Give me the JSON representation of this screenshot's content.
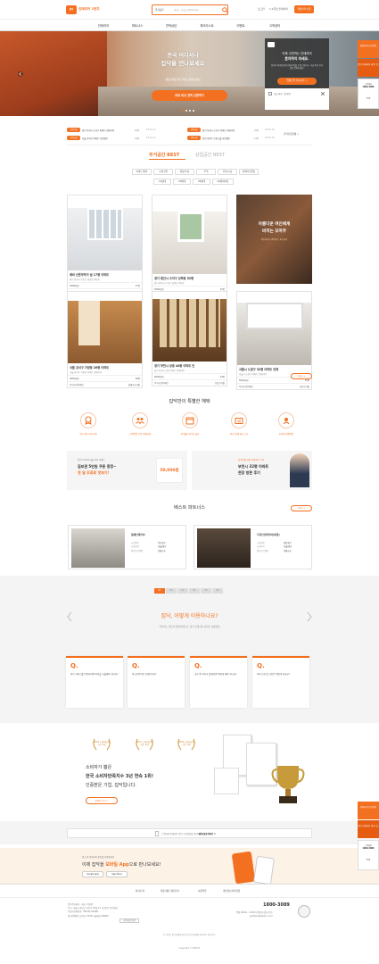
{
  "header": {
    "logo_text": "인테리어 1번지",
    "logo_badge": "집닥",
    "search_select": "주거공간",
    "search_placeholder": "원하는 공간을 검색해주세요",
    "login": "로그인",
    "phone": "1:1무료 인테리어",
    "cta": "업체견적 신청"
  },
  "nav": {
    "items": [
      "인테리어",
      "파트너스",
      "견적상담",
      "체크리스트",
      "이벤트",
      "고객센터"
    ]
  },
  "hero": {
    "title1": "전국 어디서나",
    "title2": "집닥을 만나보세요",
    "regions": "경원·대전·대구·부산·광주(호남)",
    "cta": "무료 비교 견적 신청하기",
    "popup_title": "이제 고민하는 인테리어",
    "popup_title2": "혼자하지 마세요.",
    "popup_desc": "집닥이 여러분들의 인테리어를 도와드립니다. 지금 바로 무료 상담 받아보세요.",
    "popup_btn": "업체견적 비교하기 >",
    "popup_bottom": "오늘 하루 그만보기"
  },
  "ticker": {
    "rows": [
      {
        "tag": "견적신청",
        "text": "경기 부천시 소사구 아파트 인테리어",
        "size": "25평",
        "date": "18.05.10"
      },
      {
        "tag": "견적신청",
        "text": "서울 동작구 아파트 리모델링",
        "size": "32평",
        "date": "18.05.10"
      }
    ],
    "rows2": [
      {
        "tag": "견적신청",
        "text": "경기 부천시 소사구 아파트 인테리어",
        "size": "25평",
        "date": "18.05.10"
      },
      {
        "tag": "견적신청",
        "text": "인천 부평구 오피스텔 리모델링",
        "size": "15평",
        "date": "18.05.10"
      }
    ],
    "more": "견적신청현황 >"
  },
  "best": {
    "tab_active": "주거공간 BEST",
    "tab_inactive": "상업공간 BEST",
    "chips_row1": [
      "아파트/빌라",
      "오피스텔",
      "원룸/투룸",
      "주택",
      "부분/시공",
      "전체리모델링"
    ],
    "chips_row2": [
      "10평대",
      "20평대",
      "30평대",
      "40평대이상"
    ],
    "cards": [
      {
        "title": "예비 신혼부부가 살 17평 아파트",
        "sub": "경기 안양시 동안구 관양동 아파트",
        "price": "1800만원",
        "size": "17평",
        "who": "주거공간/아파트",
        "style": "모던스타일"
      },
      {
        "title": "경기 용인시 수지구 성복동 52평",
        "sub": "경기 용인시 수지구 성복동 아파트",
        "price": "5600만원",
        "size": "52평",
        "who": "주거공간/아파트",
        "style": "내추럴스타일"
      },
      {
        "title": "서울 강서구 가양동 26평 아파트",
        "sub": "서울 강서구 가양동 아파트 인테리어",
        "price": "2650만원",
        "size": "26평",
        "who": "주거공간/아파트",
        "style": "클래식스타일"
      },
      {
        "title": "경기 부천시 상동 44평 아파트 인",
        "sub": "경기 부천시 상동 아파트 인테리어",
        "price": "6000만원",
        "size": "44평",
        "who": "주거공간/아파트",
        "style": "모던스타일"
      },
      {
        "title": "서울시 노원구 32평 아파트 인테",
        "sub": "서울시 노원구 아파트 인테리어",
        "price": "5000만원",
        "size": "32평",
        "who": "주거공간/아파트",
        "style": "모던스타일"
      }
    ],
    "feature_title1": "아름다운 여인에게",
    "feature_title2": "바치는 오마주",
    "feature_sub": "#인테리어 #아파트 #오마주",
    "more": "더보기 +"
  },
  "benefits": {
    "title": "집닥만의 특별한 혜택",
    "items": [
      "3년 무상 A/S 보증",
      "고객평점 기반 업체선정",
      "12개월 무이자 할부",
      "안심 결제 에스크로",
      "집닥맨 현장방문"
    ],
    "banner_left_small": "집닥 X Olive 웹드라마 이벤트",
    "banner_left_big": "집보관 5만원 쿠폰 증정~",
    "banner_left_accent": "첫 달 무료로 맛보기!",
    "banner_left_coupon": "50,000원",
    "banner_right_small": "집닥마켓 한정 인테리어 · 00",
    "banner_right_big1": "부천시 32평 아파트",
    "banner_right_big2": "현장 방문 후기"
  },
  "partners": {
    "title": "베스트 파트너스",
    "more": "더보기 +",
    "items": [
      {
        "name": "월세인테리어",
        "rows": [
          "시공분야",
          "시공지역",
          "파트너스평점"
        ],
        "vals": [
          "주거공간",
          "서울/경기",
          "종합시공"
        ]
      },
      {
        "name": "디자인인테리어(통합)",
        "rows": [
          "시공분야",
          "시공지역",
          "파트너스평점"
        ],
        "vals": [
          "상업공간",
          "서울/경기",
          "종합시공"
        ]
      }
    ],
    "pager": [
      "01",
      "02",
      "03",
      "04",
      "05",
      "06"
    ]
  },
  "howto": {
    "title": "집닥, 어떻게 이용하나요?",
    "sub": "자주하는 질문과 함께 알아보는 집닥 인테리어 서비스 이용방법",
    "q_mark": "Q.",
    "questions": [
      "집닥 서비스를 이용하려면 비용을 지불해야 하나요?",
      "비교견적이란 무엇인가요?",
      "공사 중 하자가 발생하면 어떻게 해야 하나요?",
      "A/S 신청 및 기간은 어떻게 되나요?"
    ]
  },
  "awards": {
    "medals": [
      "2016 소비자만족지수 1위",
      "2017 소비자만족지수 1위",
      "2018 소비자만족지수 1위"
    ],
    "line1": "소비자가 뽑은",
    "line2": "한국 소비자만족지수 3년 연속 1위!",
    "line3": "인증받은 기업, 집닥입니다.",
    "btn": "인증서 보기 +"
  },
  "notice": {
    "text": "고객님의 인테리어 파트너 대화방을 확인해보세요",
    "link": "집닥 표준계약서 >"
  },
  "app": {
    "small": "좋고 싼 인테리어 정보를 모바일에서",
    "big1": "이제 집닥을 ",
    "big_accent": "모바일 App",
    "big2": "으로 만나보세요!",
    "store1": "Google play",
    "store2": "App Store"
  },
  "footer": {
    "links": [
      "회사소개",
      "제휴/제휴 제안문의",
      "이용약관",
      "개인정보처리방침"
    ],
    "company": "집닥주식회사 · 대표: 박성민",
    "addr": "주소: 서울시 강남구 학동로 43길 11 (논현동) 집닥빌딩",
    "reg": "사업자등록번호: 785-81-00298",
    "report": "통신판매업신고번호: 2016-서울강남-00000",
    "info_btn": "사업자정보확인",
    "phone": "1800-3089",
    "hours": "평일 09:00 ~ 18:00 (주말/공휴일 휴무)",
    "email": "partners@zipdoc.co.kr",
    "bottom_note": "※ 집닥은 통신판매중개자로서 통신판매의 당사자가 아닙니다.",
    "copyright": "Copyright © ZIPDOC"
  },
  "side": {
    "tab1": "인테리어 무료견적",
    "tab2": "집닥 인테리어 파트너스",
    "call_label": "고객센터",
    "call_num": "1600-3089",
    "top": "TOP"
  },
  "colors": {
    "accent": "#f37021",
    "dark": "#333333",
    "light_bg": "#f4f4f4"
  }
}
